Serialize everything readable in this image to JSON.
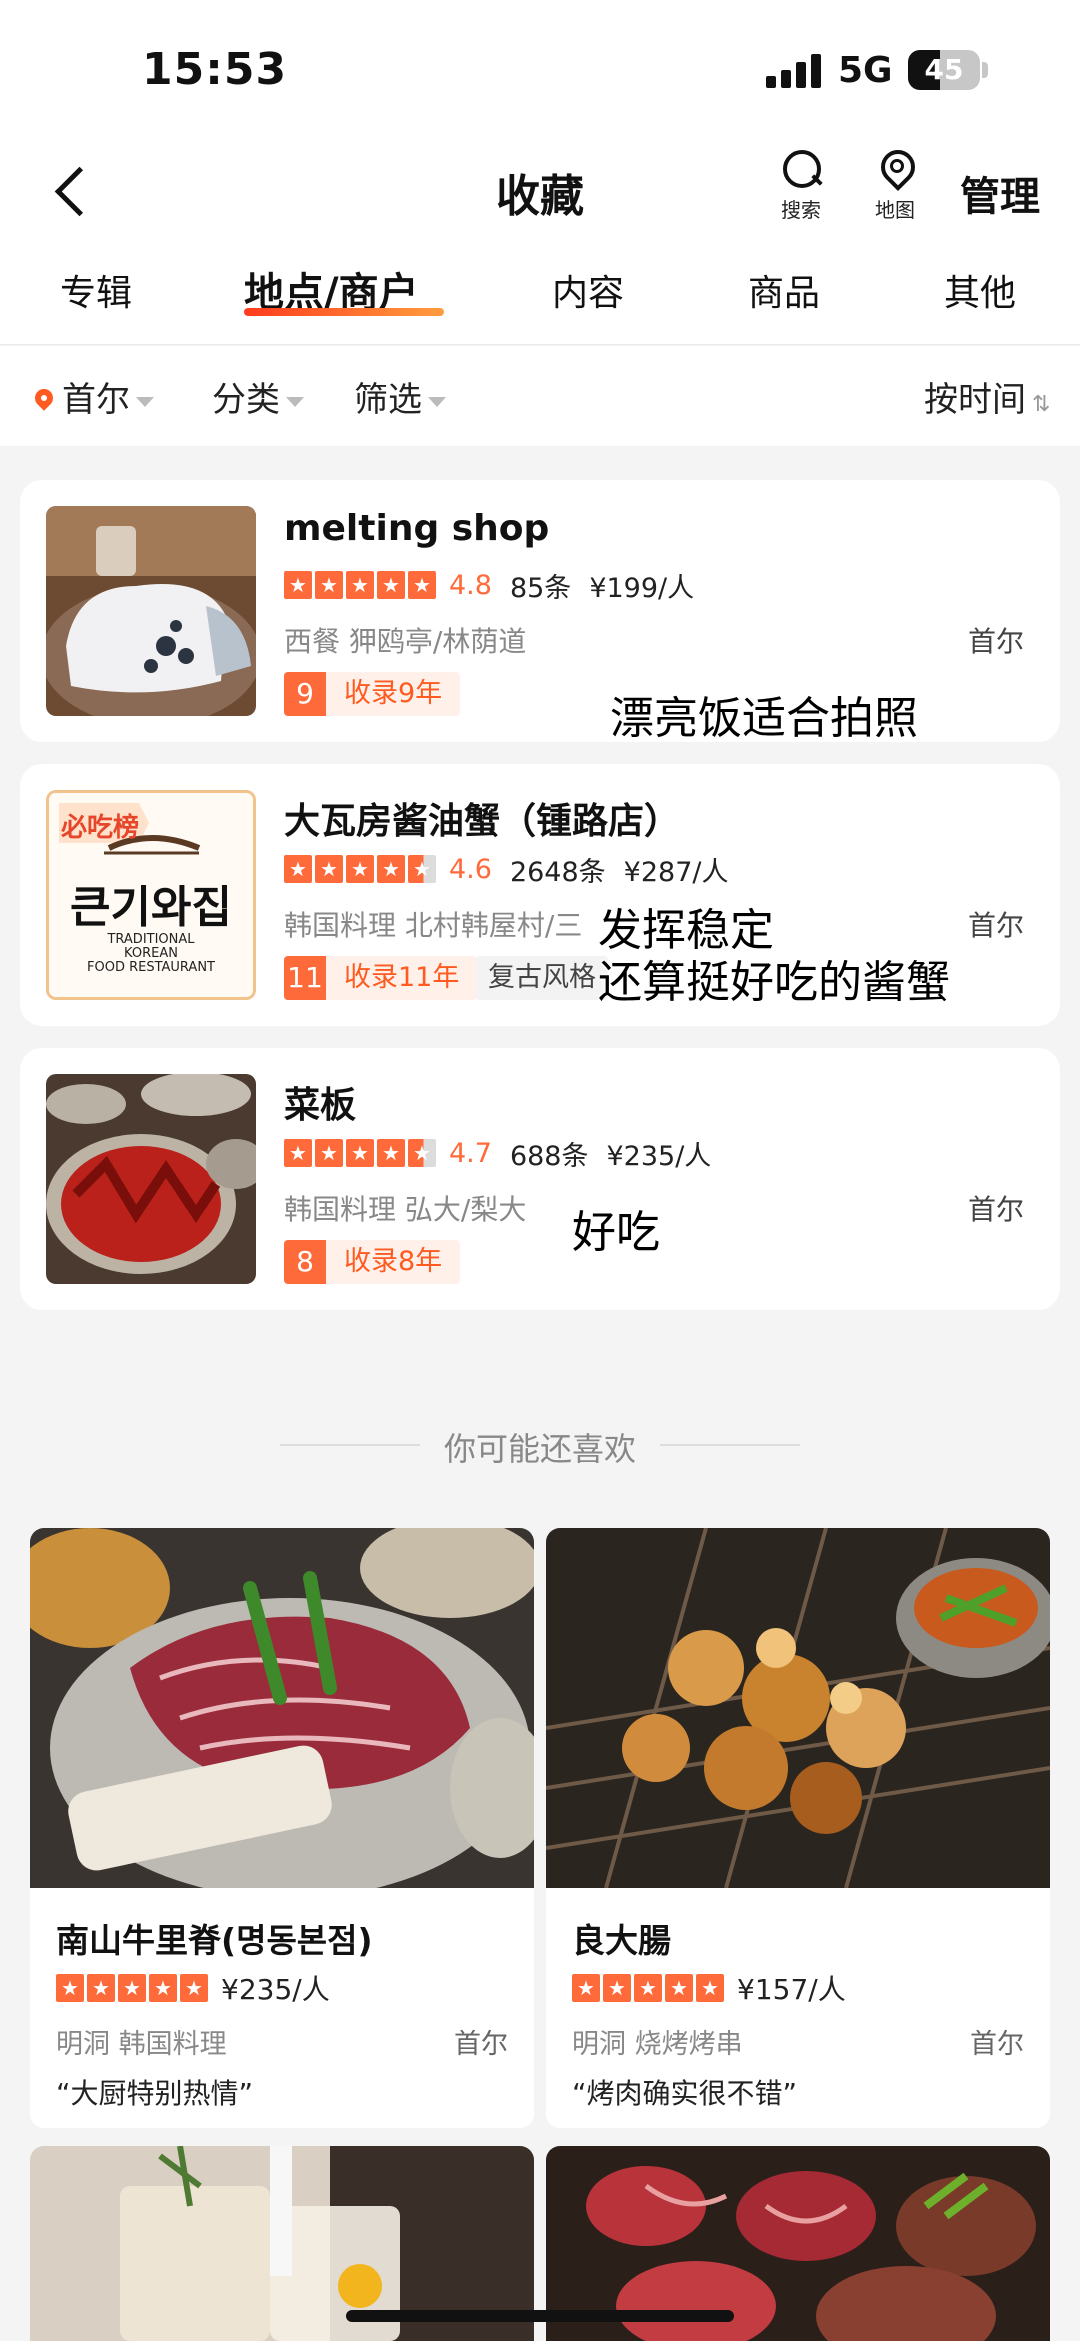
{
  "status": {
    "time": "15:53",
    "network": "5G",
    "battery": "45",
    "battery_level": 0.45
  },
  "nav": {
    "title": "收藏",
    "search_label": "搜索",
    "map_label": "地图",
    "manage_label": "管理"
  },
  "tabs": [
    "专辑",
    "地点/商户",
    "内容",
    "商品",
    "其他"
  ],
  "active_tab": "地点/商户",
  "filters": {
    "city": "首尔",
    "category": "分类",
    "filter": "筛选",
    "sort": "按时间",
    "sort_icon": "⇅"
  },
  "favorites": [
    {
      "name": "melting shop",
      "stars": 5,
      "score": "4.8",
      "reviews": "85条",
      "price": "¥199/人",
      "category": "西餐 狎鸥亭/林荫道",
      "city": "首尔",
      "badge_num": "9",
      "badge_text": "收录9年",
      "note": "漂亮饭适合拍照"
    },
    {
      "name": "大瓦房酱油蟹（锺路店）",
      "stars": 4.5,
      "score": "4.6",
      "reviews": "2648条",
      "price": "¥287/人",
      "category": "韩国料理 北村韩屋村/三",
      "city": "首尔",
      "badge_num": "11",
      "badge_text": "收录11年",
      "tag": "复古风格",
      "logo_badge": "必吃榜",
      "logo_korean": "큰기와집",
      "logo_sub1": "TRADITIONAL",
      "logo_sub2": "KOREAN",
      "logo_sub3": "FOOD RESTAURANT",
      "note_line1": "发挥稳定",
      "note_line2": "还算挺好吃的酱蟹"
    },
    {
      "name": "菜板",
      "stars": 4.5,
      "score": "4.7",
      "reviews": "688条",
      "price": "¥235/人",
      "category": "韩国料理 弘大/梨大",
      "city": "首尔",
      "badge_num": "8",
      "badge_text": "收录8年",
      "note": "好吃"
    }
  ],
  "recommend_title": "你可能还喜欢",
  "recommendations": [
    {
      "name": "南山牛里脊(명동본점)",
      "stars": 5,
      "price": "¥235/人",
      "category": "明洞 韩国料理",
      "city": "首尔",
      "quote": "“大厨特别热情”"
    },
    {
      "name": "良大腸",
      "stars": 5,
      "price": "¥157/人",
      "category": "明洞 烧烤烤串",
      "city": "首尔",
      "quote": "“烤肉确实很不错”"
    }
  ]
}
